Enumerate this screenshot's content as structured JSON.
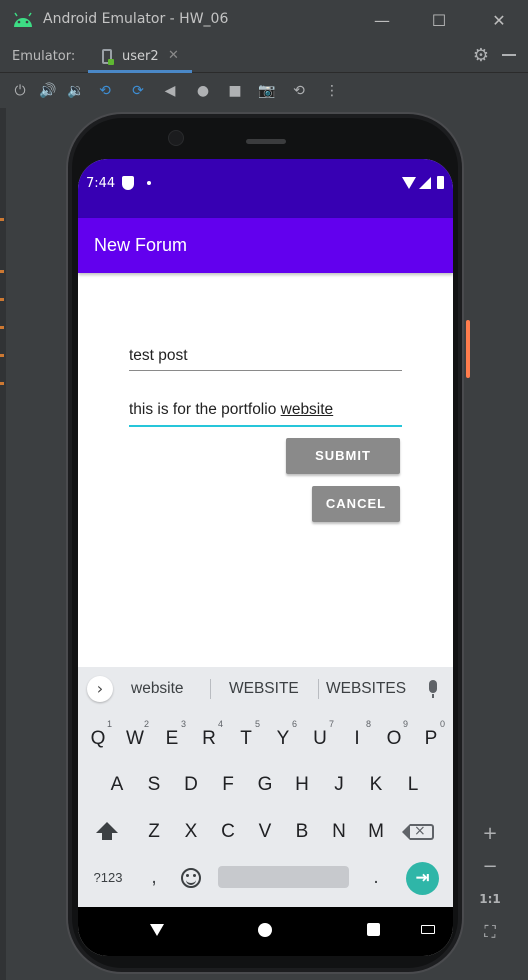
{
  "window": {
    "title": "Android Emulator - HW_06",
    "minimize": "—",
    "maximize": "☐",
    "close": "✕"
  },
  "tabbar": {
    "emulator_label": "Emulator:",
    "tab_label": "user2",
    "tab_close": "✕",
    "settings_glyph": "⚙"
  },
  "toolbar": {
    "power": "⏻",
    "volume_up": "🔊",
    "volume_down": "🔉",
    "rotate_left": "⟲",
    "rotate_right": "⟳",
    "back": "◀",
    "home": "●",
    "overview": "■",
    "screenshot": "📷",
    "snapshot": "⟲",
    "more": "⋮"
  },
  "side_panel": {
    "zoom_in": "+",
    "zoom_out": "−",
    "one_to_one": "1:1",
    "fit": "⛶"
  },
  "status_bar": {
    "time": "7:44"
  },
  "app_bar": {
    "title": "New Forum"
  },
  "form": {
    "title_value": "test post",
    "body_value_prefix": "this is for the portfolio ",
    "body_value_composing": "website",
    "submit_label": "SUBMIT",
    "cancel_label": "CANCEL"
  },
  "keyboard": {
    "suggestions": [
      "website",
      "WEBSITE",
      "WEBSITES"
    ],
    "row1": [
      {
        "k": "Q",
        "n": "1"
      },
      {
        "k": "W",
        "n": "2"
      },
      {
        "k": "E",
        "n": "3"
      },
      {
        "k": "R",
        "n": "4"
      },
      {
        "k": "T",
        "n": "5"
      },
      {
        "k": "Y",
        "n": "6"
      },
      {
        "k": "U",
        "n": "7"
      },
      {
        "k": "I",
        "n": "8"
      },
      {
        "k": "O",
        "n": "9"
      },
      {
        "k": "P",
        "n": "0"
      }
    ],
    "row2": [
      "A",
      "S",
      "D",
      "F",
      "G",
      "H",
      "J",
      "K",
      "L"
    ],
    "row3": [
      "Z",
      "X",
      "C",
      "V",
      "B",
      "N",
      "M"
    ],
    "symbols_label": "?123",
    "comma": ",",
    "period": ".",
    "enter_glyph": "⇥",
    "expand_glyph": "›"
  }
}
